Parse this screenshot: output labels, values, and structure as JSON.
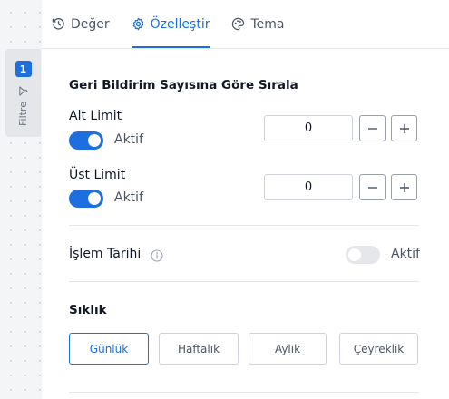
{
  "filter": {
    "count": "1",
    "label": "Filtre"
  },
  "tabs": [
    {
      "label": "Değer",
      "icon": "history-icon",
      "active": false
    },
    {
      "label": "Özelleştir",
      "icon": "gear-icon",
      "active": true
    },
    {
      "label": "Tema",
      "icon": "palette-icon",
      "active": false
    }
  ],
  "sort": {
    "title": "Geri Bildirim Sayısına Göre Sırala",
    "lower": {
      "label": "Alt Limit",
      "toggle_label": "Aktif",
      "enabled": true,
      "value": "0"
    },
    "upper": {
      "label": "Üst Limit",
      "toggle_label": "Aktif",
      "enabled": true,
      "value": "0"
    }
  },
  "process_date": {
    "label": "İşlem Tarihi",
    "toggle_label": "Aktif",
    "enabled": false
  },
  "frequency": {
    "title": "Sıklık",
    "options": [
      "Günlük",
      "Haftalık",
      "Aylık",
      "Çeyreklik"
    ],
    "selected": "Günlük"
  },
  "colors": {
    "accent": "#1d6fe0",
    "border": "#cfd3d9",
    "text": "#111827",
    "muted": "#4b5563"
  }
}
